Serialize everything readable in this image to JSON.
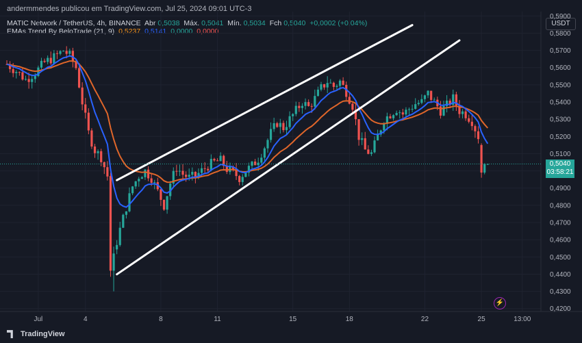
{
  "header": {
    "published": "andermmendes publicou em TradingView.com, Jul 25, 2024 09:01 UTC-3"
  },
  "legend": {
    "symbol": "MATIC Network / TetherUS, 4h, BINANCE",
    "open_label": "Abr",
    "open": "0,5038",
    "high_label": "Máx.",
    "high": "0,5041",
    "low_label": "Mín.",
    "low": "0,5034",
    "close_label": "Fch",
    "close": "0,5040",
    "change": "+0,0002 (+0,04%)",
    "indicator": "EMAs Trend By BeloTrade (21, 9)",
    "ema21": "0,5237",
    "ema9": "0,5141",
    "v3": "0,0000",
    "v4": "0,0000"
  },
  "currency": "USDT",
  "price_tag": {
    "price": "0,5040",
    "countdown": "03:58:21"
  },
  "footer": {
    "brand": "TradingView"
  },
  "colors": {
    "up": "#26a69a",
    "down": "#ef5350",
    "ema_long": "#e0662a",
    "ema_short": "#2962ff",
    "trendline": "#ffffff"
  },
  "chart_data": {
    "type": "candlestick",
    "ylim": [
      0.4183,
      0.5925
    ],
    "y_ticks": [
      "0,5900",
      "0,5800",
      "0,5700",
      "0,5600",
      "0,5500",
      "0,5400",
      "0,5300",
      "0,5200",
      "0,5100",
      "0,5000",
      "0,4900",
      "0,4800",
      "0,4700",
      "0,4600",
      "0,4500",
      "0,4400",
      "0,4300",
      "0,4200"
    ],
    "x_ticks": [
      {
        "label": "Jul",
        "i": 10
      },
      {
        "label": "4",
        "i": 25
      },
      {
        "label": "8",
        "i": 49
      },
      {
        "label": "11",
        "i": 67
      },
      {
        "label": "15",
        "i": 91
      },
      {
        "label": "18",
        "i": 109
      },
      {
        "label": "22",
        "i": 133
      },
      {
        "label": "25",
        "i": 151
      },
      {
        "label": "13:00",
        "i": 164
      }
    ],
    "candles": [],
    "anchors": [
      [
        0,
        0.562
      ],
      [
        3,
        0.558
      ],
      [
        6,
        0.553
      ],
      [
        9,
        0.557
      ],
      [
        12,
        0.563
      ],
      [
        15,
        0.566
      ],
      [
        18,
        0.57
      ],
      [
        20,
        0.567
      ],
      [
        22,
        0.56
      ],
      [
        24,
        0.54
      ],
      [
        26,
        0.522
      ],
      [
        28,
        0.512
      ],
      [
        30,
        0.508
      ],
      [
        32,
        0.497
      ],
      [
        33,
        0.44
      ],
      [
        34,
        0.452
      ],
      [
        36,
        0.466
      ],
      [
        38,
        0.479
      ],
      [
        40,
        0.491
      ],
      [
        42,
        0.497
      ],
      [
        44,
        0.5
      ],
      [
        46,
        0.496
      ],
      [
        48,
        0.488
      ],
      [
        50,
        0.48
      ],
      [
        52,
        0.493
      ],
      [
        54,
        0.502
      ],
      [
        56,
        0.498
      ],
      [
        58,
        0.496
      ],
      [
        60,
        0.497
      ],
      [
        62,
        0.5
      ],
      [
        64,
        0.503
      ],
      [
        66,
        0.505
      ],
      [
        68,
        0.506
      ],
      [
        70,
        0.501
      ],
      [
        72,
        0.499
      ],
      [
        74,
        0.496
      ],
      [
        76,
        0.5
      ],
      [
        78,
        0.503
      ],
      [
        80,
        0.507
      ],
      [
        82,
        0.514
      ],
      [
        84,
        0.522
      ],
      [
        86,
        0.528
      ],
      [
        88,
        0.525
      ],
      [
        90,
        0.53
      ],
      [
        92,
        0.535
      ],
      [
        94,
        0.54
      ],
      [
        96,
        0.537
      ],
      [
        98,
        0.542
      ],
      [
        100,
        0.548
      ],
      [
        102,
        0.552
      ],
      [
        104,
        0.549
      ],
      [
        106,
        0.552
      ],
      [
        108,
        0.546
      ],
      [
        110,
        0.538
      ],
      [
        112,
        0.52
      ],
      [
        114,
        0.512
      ],
      [
        116,
        0.51
      ],
      [
        118,
        0.52
      ],
      [
        120,
        0.53
      ],
      [
        122,
        0.533
      ],
      [
        124,
        0.536
      ],
      [
        126,
        0.533
      ],
      [
        128,
        0.536
      ],
      [
        130,
        0.539
      ],
      [
        132,
        0.54
      ],
      [
        134,
        0.545
      ],
      [
        136,
        0.54
      ],
      [
        138,
        0.535
      ],
      [
        140,
        0.538
      ],
      [
        142,
        0.542
      ],
      [
        144,
        0.535
      ],
      [
        146,
        0.533
      ],
      [
        148,
        0.529
      ],
      [
        150,
        0.52
      ],
      [
        151,
        0.5
      ],
      [
        152,
        0.502
      ],
      [
        153,
        0.504
      ]
    ],
    "trendlines": [
      {
        "name": "upper",
        "p1": [
          35,
          0.4946
        ],
        "p2": [
          129,
          0.5847
        ]
      },
      {
        "name": "lower",
        "p1": [
          35,
          0.4399
        ],
        "p2": [
          144,
          0.5758
        ]
      }
    ],
    "ema_long_name": "EMA 21",
    "ema_short_name": "EMA 9",
    "last_price": 0.504
  }
}
